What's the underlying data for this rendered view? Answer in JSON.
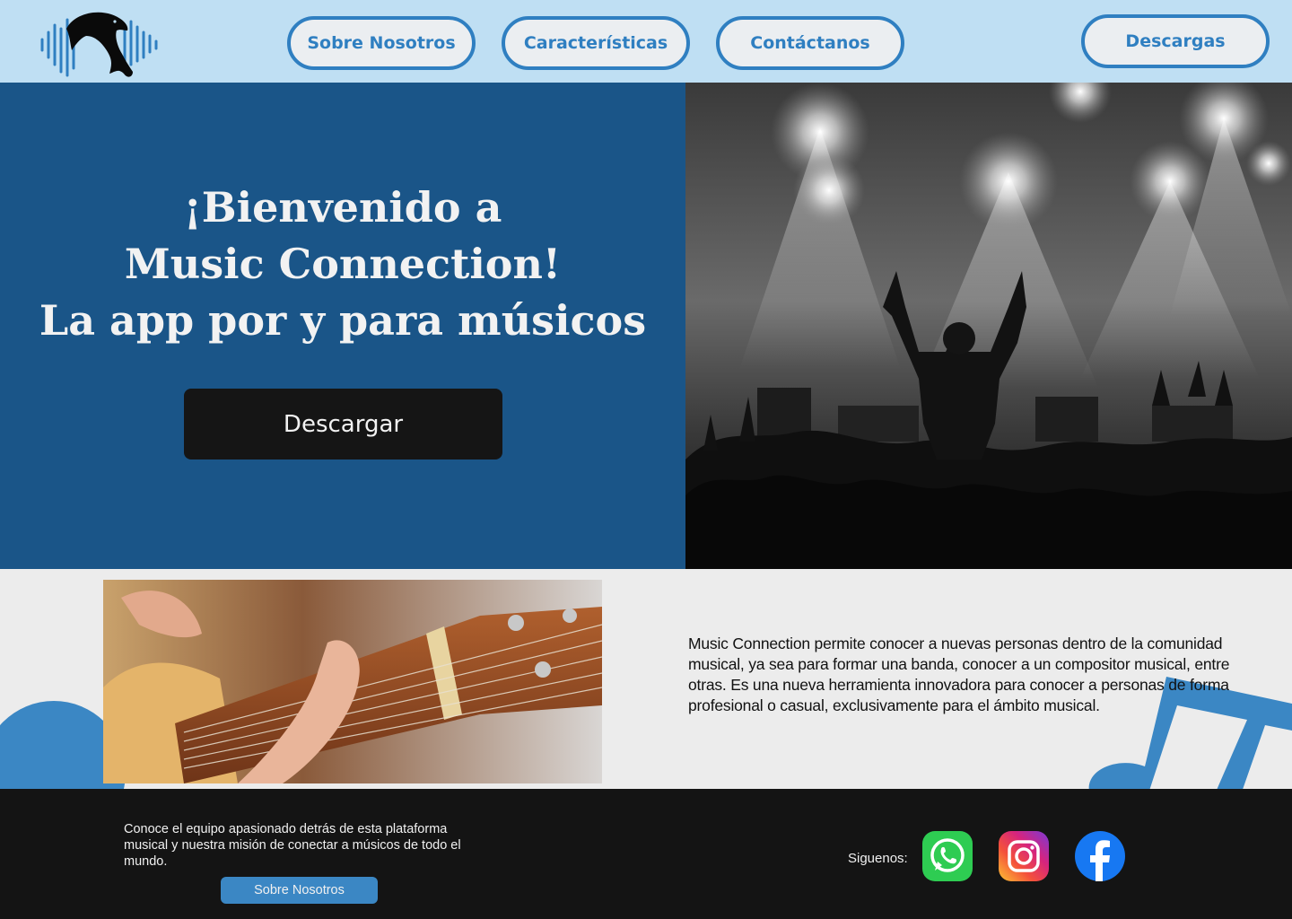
{
  "nav": {
    "about": "Sobre Nosotros",
    "features": "Características",
    "contact": "Contáctanos",
    "downloads": "Descargas"
  },
  "hero": {
    "title_line1": "¡Bienvenido a",
    "title_line2": "Music Connection!",
    "title_line3": "La app por y para músicos",
    "cta": "Descargar"
  },
  "intro": {
    "text": "Music Connection permite conocer a nuevas personas  dentro de la comunidad musical, ya sea para formar una banda, conocer a un compositor musical, entre otras. Es una nueva herramienta innovadora para conocer a personas de forma profesional o casual, exclusivamente para el ámbito musical."
  },
  "footer": {
    "text": "Conoce el equipo apasionado detrás de esta plataforma musical y nuestra misión de conectar a músicos de todo el mundo.",
    "button": "Sobre Nosotros",
    "follow": "Siguenos:",
    "socials": [
      "whatsapp-icon",
      "instagram-icon",
      "facebook-icon"
    ]
  },
  "colors": {
    "header_bg": "#bfdff3",
    "accent": "#2f7fc1",
    "hero_bg": "#1a5588",
    "footer_bg": "#141414",
    "cta_bg": "#151515"
  }
}
